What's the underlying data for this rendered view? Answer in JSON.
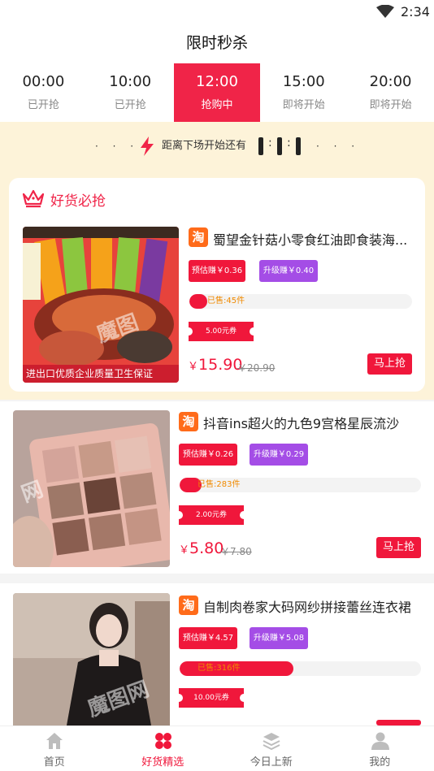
{
  "status_bar": {
    "time": "2:34"
  },
  "header": {
    "title": "限时秒杀"
  },
  "tabs": [
    {
      "time": "00:00",
      "status": "已开抢"
    },
    {
      "time": "10:00",
      "status": "已开抢"
    },
    {
      "time": "12:00",
      "status": "抢购中"
    },
    {
      "time": "15:00",
      "status": "即将开始"
    },
    {
      "time": "20:00",
      "status": "即将开始"
    }
  ],
  "countdown": {
    "label": "距离下场开始还有"
  },
  "section": {
    "title": "好货必抢"
  },
  "products": [
    {
      "title": "蜀望金针菇小零食红油即食装海...",
      "tag_estimate": "预估赚￥0.36",
      "tag_upgrade": "升级赚￥0.40",
      "sold": "已售:45件",
      "sold_fraction": 0.08,
      "coupon": "5.00元券",
      "yen": "￥",
      "price": "15.90",
      "original_price": "￥20.90",
      "buy_label": "马上抢",
      "image_caption": "进出口优质企业质量卫生保证"
    },
    {
      "title": "抖音ins超火的九色9宫格星辰流沙",
      "tag_estimate": "预估赚￥0.26",
      "tag_upgrade": "升级赚￥0.29",
      "sold": "已售:283件",
      "sold_fraction": 0.09,
      "coupon": "2.00元券",
      "yen": "￥",
      "price": "5.80",
      "original_price": "￥7.80",
      "buy_label": "马上抢"
    },
    {
      "title": "自制肉卷家大码网纱拼接蕾丝连衣裙",
      "tag_estimate": "预估赚￥4.57",
      "tag_upgrade": "升级赚￥5.08",
      "sold": "已售:316件",
      "sold_fraction": 0.47,
      "coupon": "10.00元券",
      "yen": "￥",
      "price": "",
      "original_price": "",
      "buy_label": ""
    }
  ],
  "bottom_nav": [
    {
      "label": "首页",
      "icon": "home-icon"
    },
    {
      "label": "好货精选",
      "icon": "clover-icon"
    },
    {
      "label": "今日上新",
      "icon": "layers-icon"
    },
    {
      "label": "我的",
      "icon": "user-icon"
    }
  ],
  "colors": {
    "accent": "#f02448",
    "upgrade_purple": "#a44de6",
    "banner_bg": "#fdf3d9",
    "taobao_orange": "#ff6b1a"
  }
}
